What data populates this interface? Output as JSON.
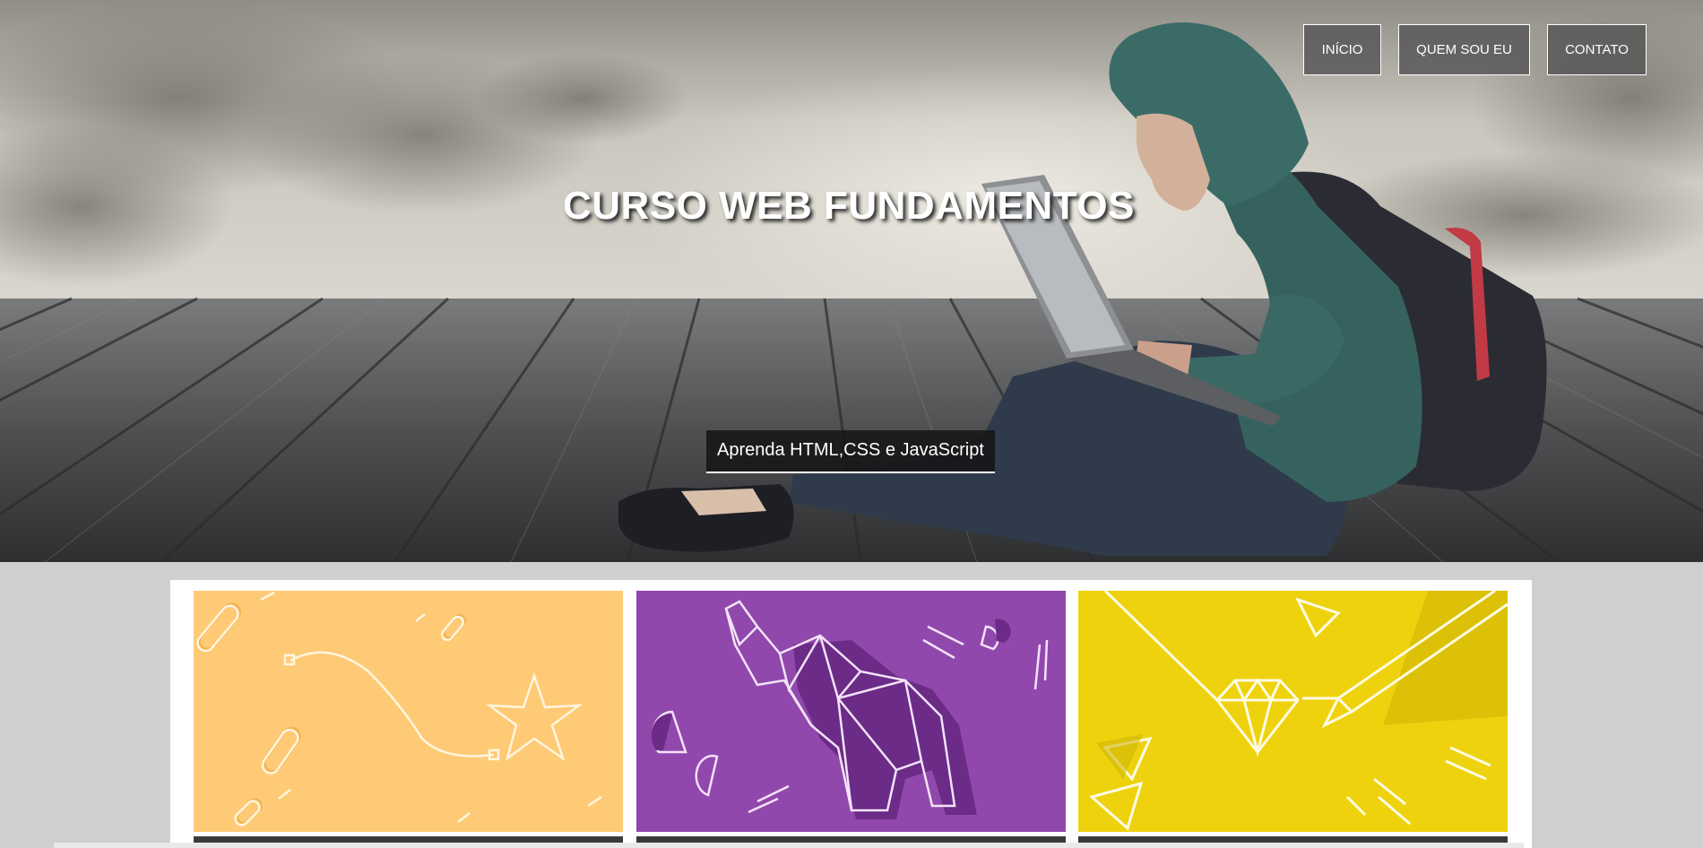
{
  "hero": {
    "title": "CURSO WEB FUNDAMENTOS",
    "subtitle": "Aprenda HTML,CSS e JavaScript"
  },
  "nav": {
    "items": [
      {
        "label": "INÍCIO"
      },
      {
        "label": "QUEM SOU EU"
      },
      {
        "label": "CONTATO"
      }
    ]
  },
  "cards": [
    {
      "illustration": "star-path-illustration",
      "color": "#FFCA76"
    },
    {
      "illustration": "origami-elephant-illustration",
      "color": "#9148AC"
    },
    {
      "illustration": "diamond-pencil-illustration",
      "color": "#EED20E"
    }
  ]
}
